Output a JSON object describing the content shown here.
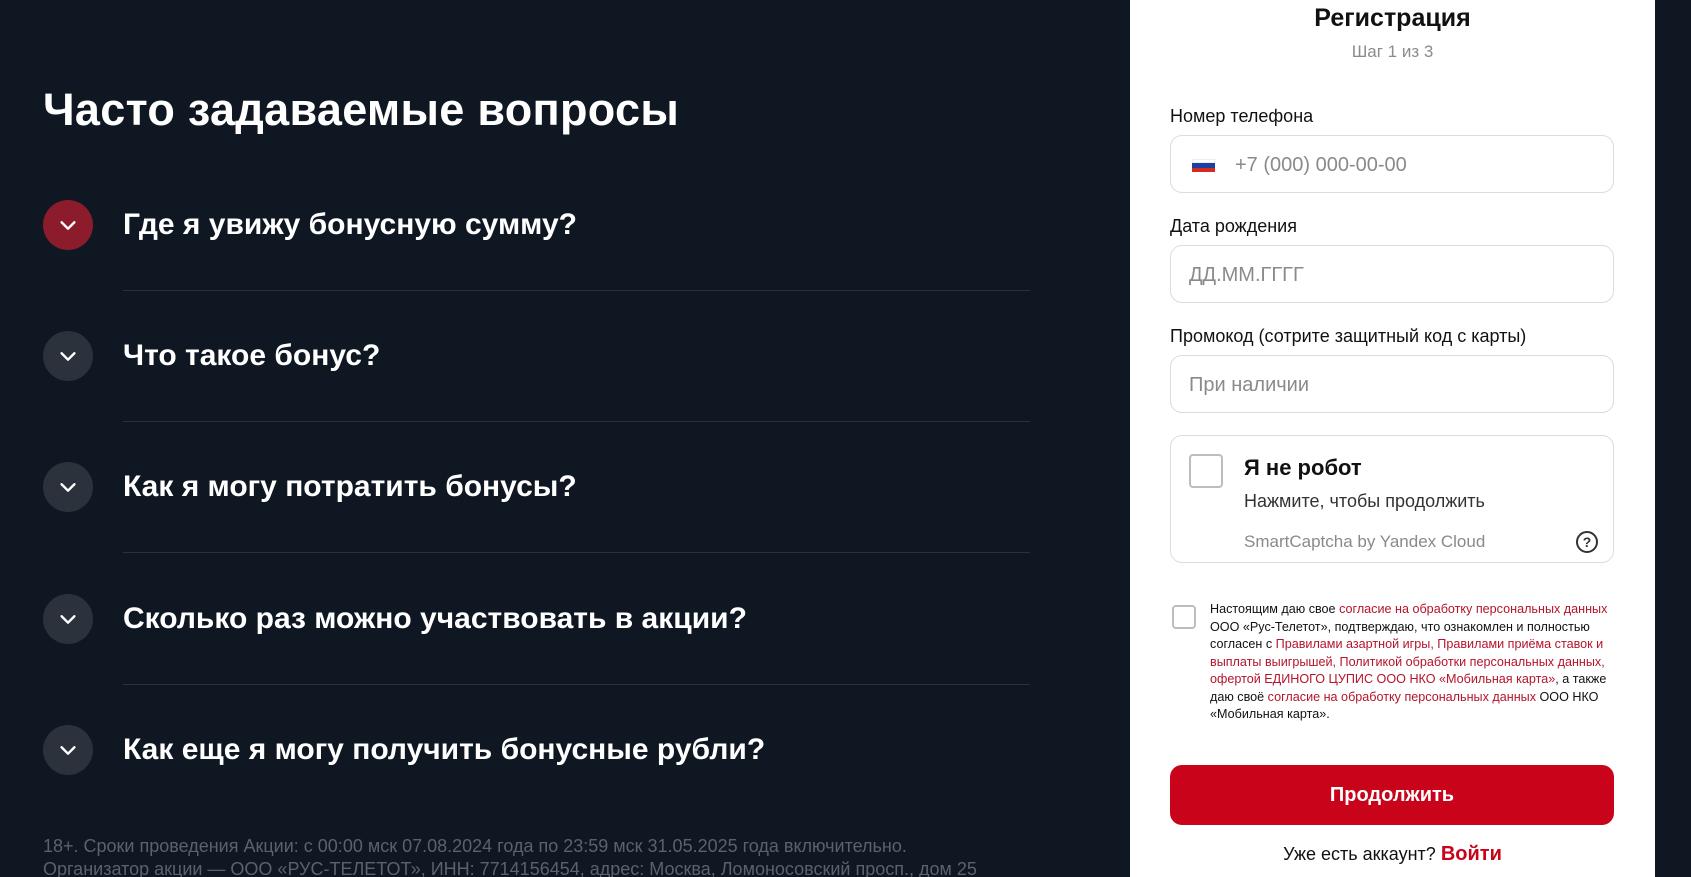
{
  "faq": {
    "title": "Часто задаваемые вопросы",
    "items": [
      {
        "question": "Где я увижу бонусную сумму?",
        "expanded": true
      },
      {
        "question": "Что такое бонус?",
        "expanded": false
      },
      {
        "question": "Как я могу потратить бонусы?",
        "expanded": false
      },
      {
        "question": "Сколько раз можно участвовать в акции?",
        "expanded": false
      },
      {
        "question": "Как еще я могу получить бонусные рубли?",
        "expanded": false
      }
    ],
    "footer_line1": "18+. Сроки проведения Акции: с 00:00 мск 07.08.2024 года по 23:59 мск 31.05.2025 года включительно.",
    "footer_line2": "Организатор акции — ООО «РУС-ТЕЛЕТОТ», ИНН: 7714156454, адрес: Москва, Ломоносовский просп., дом 25"
  },
  "registration": {
    "title": "Регистрация",
    "step": "Шаг 1 из 3",
    "phone": {
      "label": "Номер телефона",
      "placeholder": "+7 (000) 000-00-00"
    },
    "birthdate": {
      "label": "Дата рождения",
      "placeholder": "ДД.ММ.ГГГГ"
    },
    "promo": {
      "label": "Промокод (сотрите защитный код с карты)",
      "placeholder": "При наличии"
    },
    "captcha": {
      "title": "Я не робот",
      "subtitle": "Нажмите, чтобы продолжить",
      "brand": "SmartCaptcha by Yandex Cloud",
      "help": "?"
    },
    "consent": {
      "t1": "Настоящим даю свое ",
      "l1": "согласие на обработку персональных данных",
      "t2": " ООО «Рус-Телетот», подтверждаю, что ознакомлен и полностью согласен с ",
      "l2": "Правилами азартной игры, Правилами приёма ставок и выплаты выигрышей, Политикой обработки персональных данных, офертой ЕДИНОГО ЦУПИС ООО НКО «Мобильная карта»",
      "t3": ", а также даю своё ",
      "l3": "согласие на обработку персональных данных",
      "t4": " ООО НКО «Мобильная карта»."
    },
    "submit_label": "Продолжить",
    "login_prompt": "Уже есть аккаунт?",
    "login_link": "Войти"
  },
  "colors": {
    "background": "#0f1722",
    "accent": "#c8031a",
    "active_toggle": "#8c1c2c",
    "inactive_toggle": "#2b323c",
    "flag_white": "#ffffff",
    "flag_blue": "#1c3fa3",
    "flag_red": "#d52b1e"
  },
  "icons": {
    "toggle": "chevron-down-icon",
    "flag": "russia-flag-icon",
    "help": "question-circle-icon"
  }
}
